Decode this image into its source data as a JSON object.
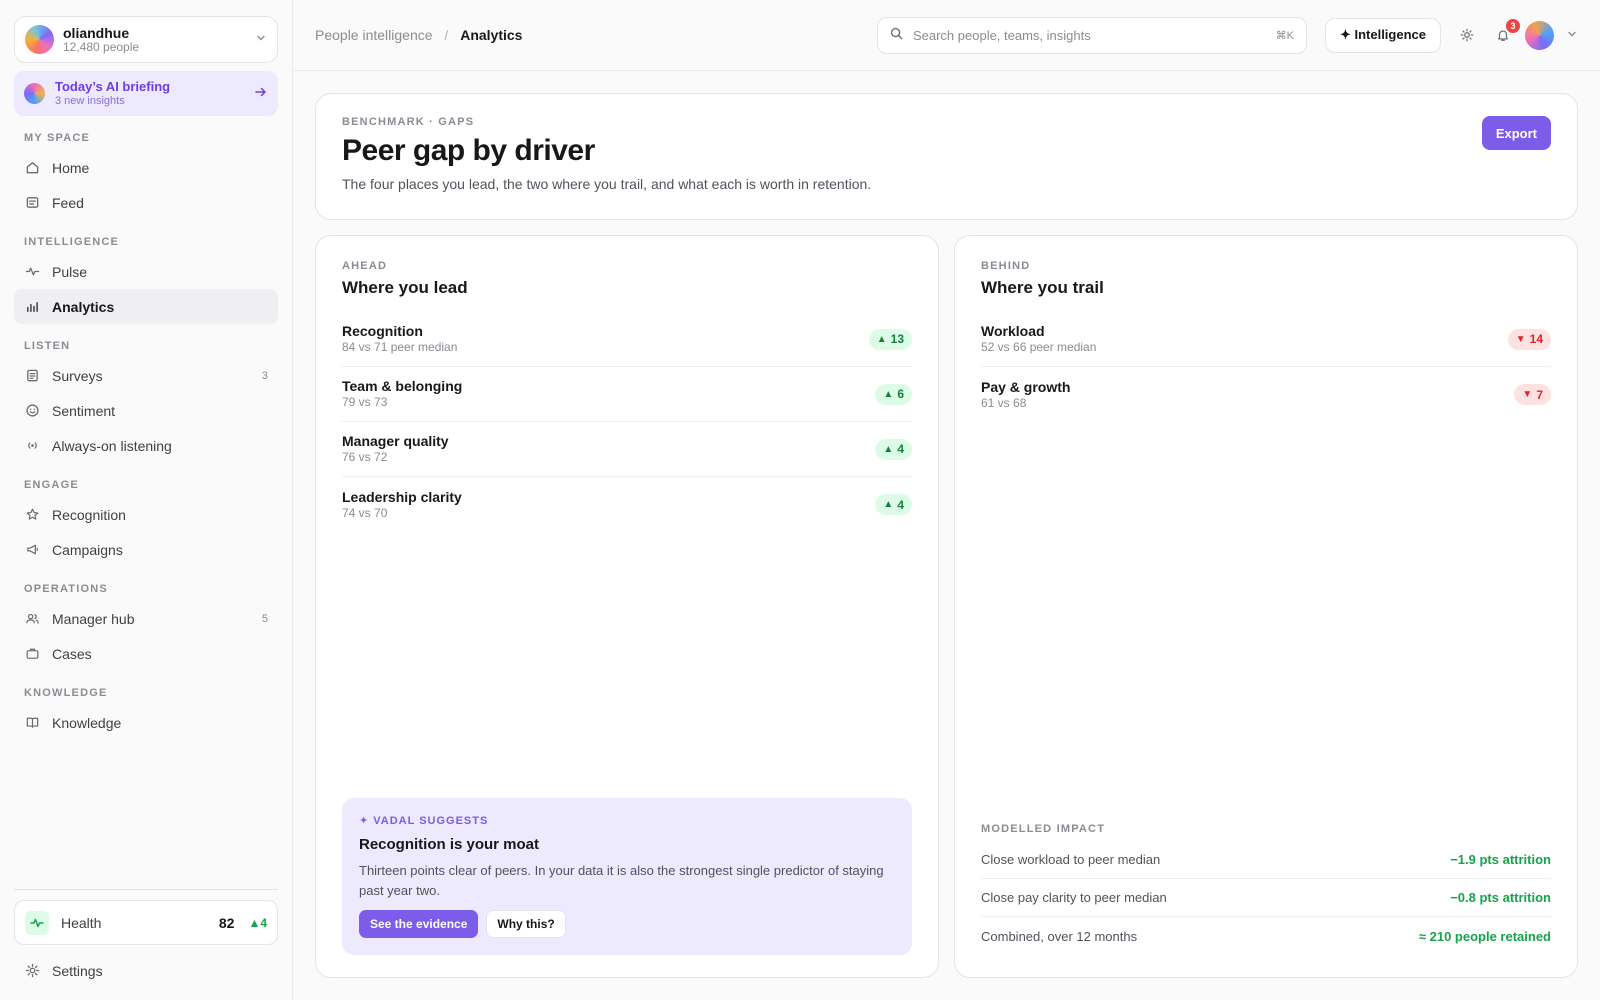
{
  "sidebar": {
    "org": {
      "name": "oliandhue",
      "sub": "12,480 people"
    },
    "briefing": {
      "title": "Today’s AI briefing",
      "sub": "3 new insights"
    },
    "sections": [
      {
        "label": "MY SPACE",
        "items": [
          {
            "label": "Home",
            "icon": "home-icon"
          },
          {
            "label": "Feed",
            "icon": "feed-icon"
          }
        ]
      },
      {
        "label": "INTELLIGENCE",
        "items": [
          {
            "label": "Pulse",
            "icon": "pulse-icon"
          },
          {
            "label": "Analytics",
            "icon": "bar-chart-icon"
          }
        ]
      },
      {
        "label": "LISTEN",
        "items": [
          {
            "label": "Surveys",
            "icon": "survey-icon",
            "badge": "3"
          },
          {
            "label": "Sentiment",
            "icon": "smile-icon"
          },
          {
            "label": "Always-on listening",
            "icon": "broadcast-icon"
          }
        ]
      },
      {
        "label": "ENGAGE",
        "items": [
          {
            "label": "Recognition",
            "icon": "star-icon"
          },
          {
            "label": "Campaigns",
            "icon": "megaphone-icon"
          }
        ]
      },
      {
        "label": "OPERATIONS",
        "items": [
          {
            "label": "Manager hub",
            "icon": "users-icon",
            "badge": "5"
          },
          {
            "label": "Cases",
            "icon": "briefcase-icon"
          }
        ]
      },
      {
        "label": "KNOWLEDGE",
        "items": [
          {
            "label": "Knowledge",
            "icon": "book-icon"
          }
        ]
      }
    ],
    "health": {
      "label": "Health",
      "score": "82",
      "delta": "▲4"
    },
    "settings": "Settings"
  },
  "topbar": {
    "crumb_parent": "People intelligence",
    "crumb_sep": "/",
    "crumb_current": "Analytics",
    "search_placeholder": "Search people, teams, insights",
    "search_kbd": "⌘K",
    "intelligence_label": "✦ Intelligence",
    "notifications": "3"
  },
  "hero": {
    "eyebrow": "BENCHMARK · GAPS",
    "title": "Peer gap by driver",
    "subtitle": "The four places you lead, the two where you trail, and what each is worth in retention.",
    "export_label": "Export"
  },
  "ahead": {
    "eyebrow": "AHEAD",
    "title": "Where you lead",
    "rows": [
      {
        "name": "Recognition",
        "sub": "84 vs 71 peer median",
        "gap": "13"
      },
      {
        "name": "Team & belonging",
        "sub": "79 vs 73",
        "gap": "6"
      },
      {
        "name": "Manager quality",
        "sub": "76 vs 72",
        "gap": "4"
      },
      {
        "name": "Leadership clarity",
        "sub": "74 vs 70",
        "gap": "4"
      }
    ],
    "suggest": {
      "eyebrow": "✦ VADAL SUGGESTS",
      "title": "Recognition is your moat",
      "body": "Thirteen points clear of peers. In your data it is also the strongest single predictor of staying past year two.",
      "primary": "See the evidence",
      "secondary": "Why this?"
    }
  },
  "behind": {
    "eyebrow": "BEHIND",
    "title": "Where you trail",
    "rows": [
      {
        "name": "Workload",
        "sub": "52 vs 66 peer median",
        "gap": "14"
      },
      {
        "name": "Pay & growth",
        "sub": "61 vs 68",
        "gap": "7"
      }
    ],
    "impact": {
      "label": "MODELLED IMPACT",
      "rows": [
        {
          "label": "Close workload to peer median",
          "value": "−1.9 pts attrition"
        },
        {
          "label": "Close pay clarity to peer median",
          "value": "−0.8 pts attrition"
        },
        {
          "label": "Combined, over 12 months",
          "value": "≈ 210 people retained"
        }
      ]
    }
  },
  "colors": {
    "accent": "#7c5ce8",
    "positive": "#16a34a",
    "negative": "#dc2626"
  }
}
